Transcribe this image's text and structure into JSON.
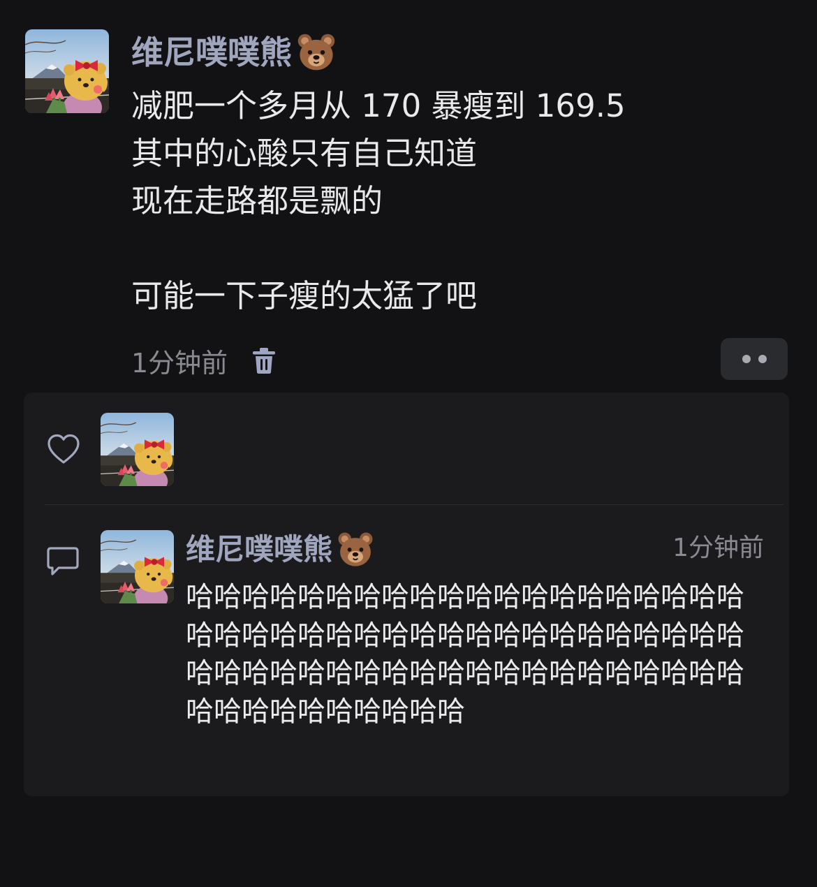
{
  "post": {
    "author_name": "维尼噗噗熊",
    "author_emoji": "bear-face",
    "lines": [
      "减肥一个多月从 170 暴瘦到 169.5",
      "其中的心酸只有自己知道",
      "现在走路都是飘的",
      "",
      "可能一下子瘦的太猛了吧"
    ],
    "time": "1分钟前",
    "delete_icon": "trash-icon",
    "more_icon": "more-dots-icon"
  },
  "likes": {
    "icon": "heart-icon"
  },
  "comment": {
    "icon": "comment-bubble-icon",
    "author_name": "维尼噗噗熊",
    "time": "1分钟前",
    "text": "哈哈哈哈哈哈哈哈哈哈哈哈哈哈哈哈哈哈哈哈哈哈哈哈哈哈哈哈哈哈哈哈哈哈哈哈哈哈哈哈哈哈哈哈哈哈哈哈哈哈哈哈哈哈哈哈哈哈哈哈哈哈哈哈哈哈哈哈哈哈"
  },
  "colors": {
    "background": "#121214",
    "panel": "#1b1b1e",
    "name": "#9fa6bd",
    "text": "#e9e9ec",
    "muted": "#8a8b92"
  }
}
